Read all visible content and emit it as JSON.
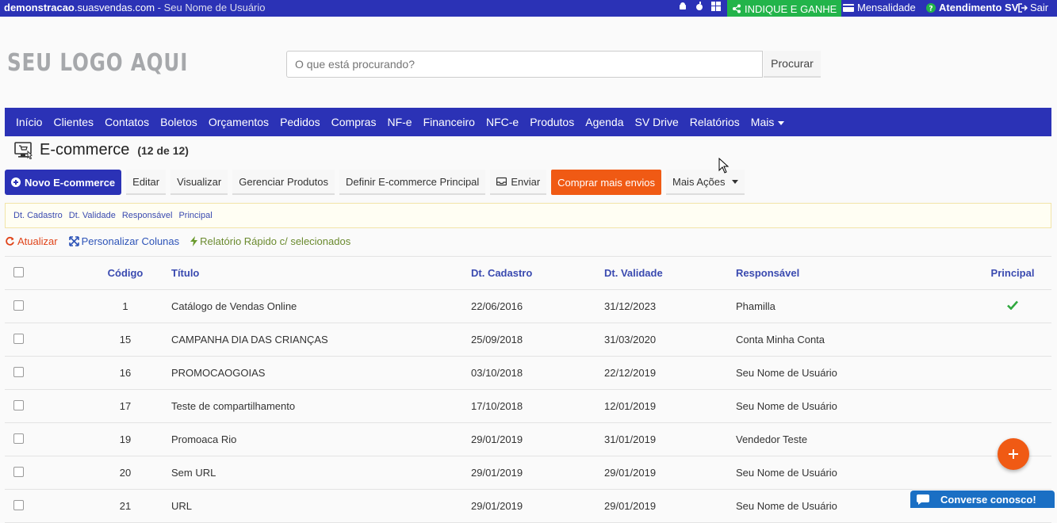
{
  "topbar": {
    "domain_bold": "demonstracao",
    "domain_rest": ".suasvendas.com",
    "separator": " - ",
    "user": "Seu Nome de Usuário",
    "indique": "INDIQUE E GANHE",
    "mensalidade": "Mensalidade",
    "atendimento": "Atendimento SV",
    "sair": "Sair"
  },
  "header": {
    "logo": "SEU LOGO AQUI",
    "search_placeholder": "O que está procurando?",
    "search_button": "Procurar"
  },
  "nav": {
    "items": [
      "Início",
      "Clientes",
      "Contatos",
      "Boletos",
      "Orçamentos",
      "Pedidos",
      "Compras",
      "NF-e",
      "Financeiro",
      "NFC-e",
      "Produtos",
      "Agenda",
      "SV Drive",
      "Relatórios"
    ],
    "more": "Mais"
  },
  "page": {
    "title": "E-commerce",
    "count": "(12 de 12)"
  },
  "actions": {
    "novo": "Novo E-commerce",
    "editar": "Editar",
    "visualizar": "Visualizar",
    "gerenciar": "Gerenciar Produtos",
    "definir": "Definir E-commerce Principal",
    "enviar": "Enviar",
    "comprar": "Comprar mais envios",
    "mais": "Mais Ações"
  },
  "sort_fields": [
    "Dt. Cadastro",
    "Dt. Validade",
    "Responsável",
    "Principal"
  ],
  "quick": {
    "atualizar": "Atualizar",
    "personalizar": "Personalizar Colunas",
    "relatorio": "Relatório Rápido c/ selecionados"
  },
  "table": {
    "headers": {
      "codigo": "Código",
      "titulo": "Título",
      "cadastro": "Dt. Cadastro",
      "validade": "Dt. Validade",
      "responsavel": "Responsável",
      "principal": "Principal"
    },
    "rows": [
      {
        "codigo": "1",
        "titulo": "Catálogo de Vendas Online",
        "cadastro": "22/06/2016",
        "validade": "31/12/2023",
        "responsavel": "Phamilla",
        "principal": true
      },
      {
        "codigo": "15",
        "titulo": "CAMPANHA DIA DAS CRIANÇAS",
        "cadastro": "25/09/2018",
        "validade": "31/03/2020",
        "responsavel": "Conta Minha Conta",
        "principal": false
      },
      {
        "codigo": "16",
        "titulo": "PROMOCAOGOIAS",
        "cadastro": "03/10/2018",
        "validade": "22/12/2019",
        "responsavel": "Seu Nome de Usuário",
        "principal": false
      },
      {
        "codigo": "17",
        "titulo": "Teste de compartilhamento",
        "cadastro": "17/10/2018",
        "validade": "12/01/2019",
        "responsavel": "Seu Nome de Usuário",
        "principal": false
      },
      {
        "codigo": "19",
        "titulo": "Promoaca Rio",
        "cadastro": "29/01/2019",
        "validade": "31/01/2019",
        "responsavel": "Vendedor Teste",
        "principal": false
      },
      {
        "codigo": "20",
        "titulo": "Sem URL",
        "cadastro": "29/01/2019",
        "validade": "29/01/2019",
        "responsavel": "Seu Nome de Usuário",
        "principal": false
      },
      {
        "codigo": "21",
        "titulo": "URL",
        "cadastro": "29/01/2019",
        "validade": "29/01/2019",
        "responsavel": "Seu Nome de Usuário",
        "principal": false
      }
    ]
  },
  "chat": {
    "label": "Converse conosco!"
  },
  "colors": {
    "brand": "#2b32b6",
    "orange": "#f05a14",
    "green": "#22b44a"
  }
}
